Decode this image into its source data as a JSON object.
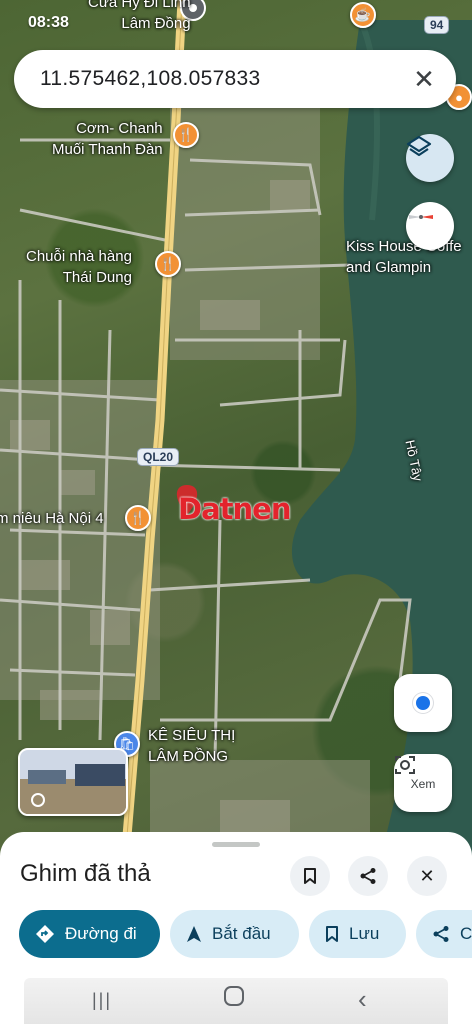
{
  "status_bar": {
    "time": "08:38"
  },
  "search": {
    "query": "11.575462,108.057833"
  },
  "map": {
    "labels": {
      "top_place": "Cửa Hỷ Đi Linh\nLâm Đồng",
      "restaurant_1": "Cơm- Chanh\nMuối Thanh Đàn",
      "restaurant_2": "Chuỗi nhà hàng\nThái Dung",
      "resort": "Kiss House Coffe\nand Glampin",
      "restaurant_3": "m niêu Hà Nội 4",
      "supermarket": "KÊ SIÊU THỊ\nLÂM ĐỒNG",
      "lake": "Hồ Tây",
      "route": "QL20",
      "route_badge": "94"
    },
    "watermark": "Datnen",
    "layers_icon": "layers-icon",
    "compass_icon": "compass-icon",
    "location_icon": "my-location-icon",
    "lens_label": "Xem"
  },
  "sheet": {
    "title": "Ghim đã thả",
    "chips": {
      "directions": "Đường đi",
      "start": "Bắt đầu",
      "save": "Lưu",
      "share": "C"
    }
  },
  "colors": {
    "primary_chip": "#0c6d8e",
    "secondary_chip": "#d8ecf6",
    "poi_orange": "#f29135",
    "water": "#2f5a4e",
    "road": "#f0d483"
  }
}
